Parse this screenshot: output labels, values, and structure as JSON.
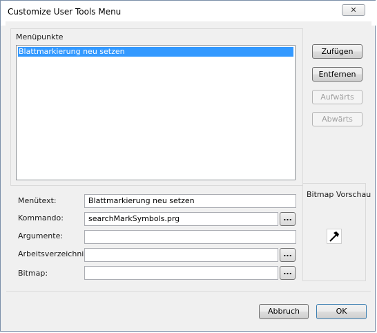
{
  "window": {
    "title": "Customize User Tools Menu",
    "close_glyph": "✕"
  },
  "menu_group": {
    "label": "Menüpunkte",
    "items": [
      "Blattmarkierung neu setzen"
    ]
  },
  "side_buttons": {
    "add": "Zufügen",
    "remove": "Entfernen",
    "up": "Aufwärts",
    "down": "Abwärts"
  },
  "fields": {
    "menutext_label": "Menütext:",
    "menutext_value": "Blattmarkierung neu setzen",
    "command_label": "Kommando:",
    "command_value": "searchMarkSymbols.prg",
    "arguments_label": "Argumente:",
    "arguments_value": "",
    "workdir_label": "Arbeitsverzeichnis:",
    "workdir_value": "",
    "bitmap_label": "Bitmap:",
    "bitmap_value": "",
    "browse_label": "..."
  },
  "preview": {
    "title": "Bitmap Vorschau",
    "icon": "hammer-icon"
  },
  "footer": {
    "cancel": "Abbruch",
    "ok": "OK"
  },
  "colors": {
    "selection": "#3399ff",
    "dialog_bg": "#f0f0f0"
  }
}
